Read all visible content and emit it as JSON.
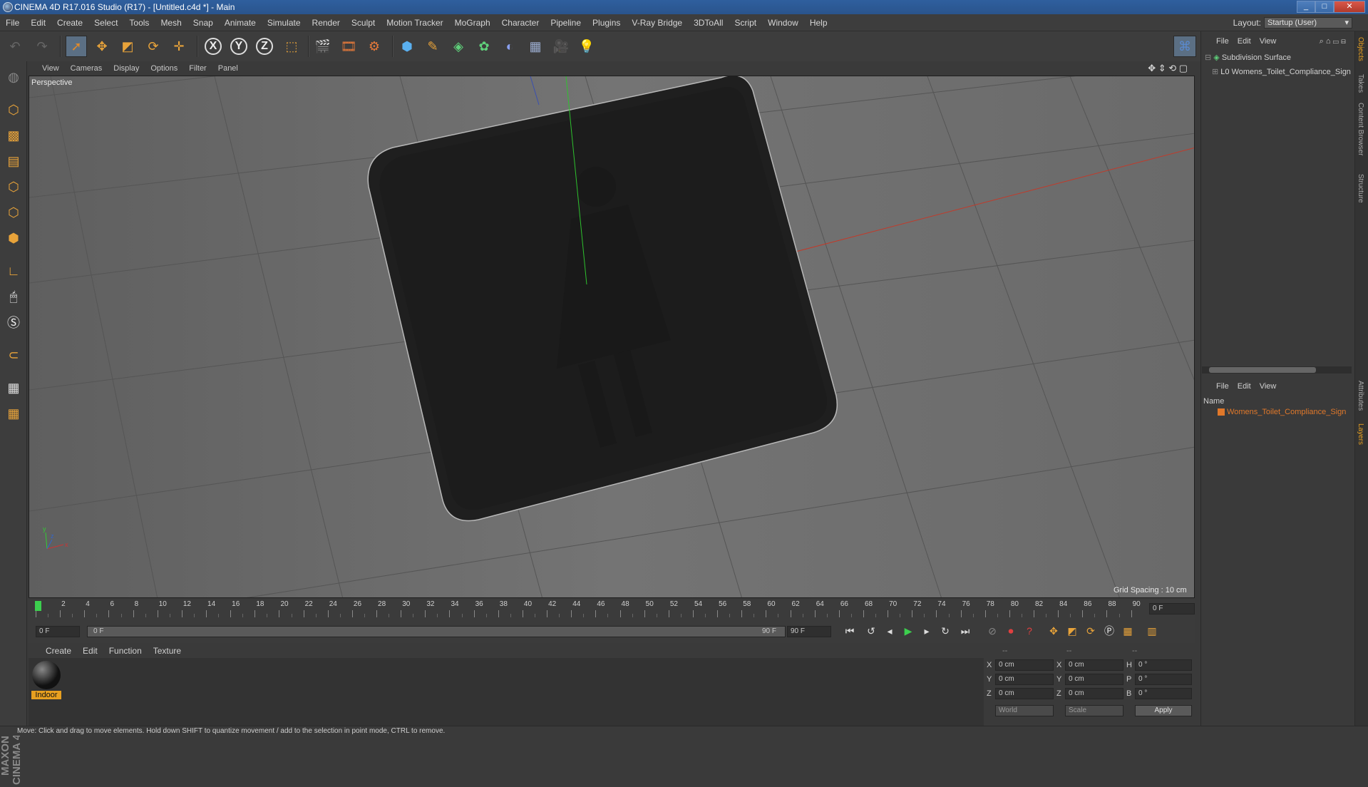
{
  "window": {
    "title": "CINEMA 4D R17.016 Studio (R17) - [Untitled.c4d *] - Main",
    "buttons": [
      "_",
      "□",
      "✕"
    ]
  },
  "menubar": {
    "items": [
      "File",
      "Edit",
      "Create",
      "Select",
      "Tools",
      "Mesh",
      "Snap",
      "Animate",
      "Simulate",
      "Render",
      "Sculpt",
      "Motion Tracker",
      "MoGraph",
      "Character",
      "Pipeline",
      "Plugins",
      "V-Ray Bridge",
      "3DToAll",
      "Script",
      "Window",
      "Help"
    ],
    "layout_label": "Layout:",
    "layout_value": "Startup (User)"
  },
  "toolbar": {
    "axis_x": "X",
    "axis_y": "Y",
    "axis_z": "Z"
  },
  "viewport": {
    "menu": [
      "View",
      "Cameras",
      "Display",
      "Options",
      "Filter",
      "Panel"
    ],
    "label": "Perspective",
    "grid_spacing": "Grid Spacing : 10 cm"
  },
  "timeline": {
    "ticks": [
      "0",
      "2",
      "4",
      "6",
      "8",
      "10",
      "12",
      "14",
      "16",
      "18",
      "20",
      "22",
      "24",
      "26",
      "28",
      "30",
      "32",
      "34",
      "36",
      "38",
      "40",
      "42",
      "44",
      "46",
      "48",
      "50",
      "52",
      "54",
      "56",
      "58",
      "60",
      "62",
      "64",
      "66",
      "68",
      "70",
      "72",
      "74",
      "76",
      "78",
      "80",
      "82",
      "84",
      "86",
      "88",
      "90"
    ],
    "current_frame": "0 F"
  },
  "playbar": {
    "start_field": "0 F",
    "range_start": "0 F",
    "range_end": "90 F",
    "end_field": "90 F"
  },
  "material_manager": {
    "menu": [
      "Create",
      "Edit",
      "Function",
      "Texture"
    ],
    "materials": [
      {
        "name": "Indoor"
      }
    ]
  },
  "coordinates": {
    "headers": [
      "--",
      "--",
      "--"
    ],
    "rows": [
      {
        "a": "X",
        "av": "0 cm",
        "b": "X",
        "bv": "0 cm",
        "c": "H",
        "cv": "0 °"
      },
      {
        "a": "Y",
        "av": "0 cm",
        "b": "Y",
        "bv": "0 cm",
        "c": "P",
        "cv": "0 °"
      },
      {
        "a": "Z",
        "av": "0 cm",
        "b": "Z",
        "bv": "0 cm",
        "c": "B",
        "cv": "0 °"
      }
    ],
    "mode1": "World",
    "mode2": "Scale",
    "apply": "Apply"
  },
  "object_manager": {
    "menu": [
      "File",
      "Edit",
      "View"
    ],
    "objects": [
      {
        "name": "Subdivision Surface"
      },
      {
        "name": "Womens_Toilet_Compliance_Sign"
      }
    ]
  },
  "layer_manager": {
    "menu": [
      "File",
      "Edit",
      "View"
    ],
    "column": "Name",
    "layers": [
      {
        "name": "Womens_Toilet_Compliance_Sign"
      }
    ],
    "layer_color": "#e0782a"
  },
  "side_tabs": [
    "Objects",
    "Takes",
    "Content Browser",
    "Structure",
    "Attributes",
    "Layers"
  ],
  "status": "Move: Click and drag to move elements. Hold down SHIFT to quantize movement / add to the selection in point mode, CTRL to remove.",
  "branding": "MAXON CINEMA 4D"
}
